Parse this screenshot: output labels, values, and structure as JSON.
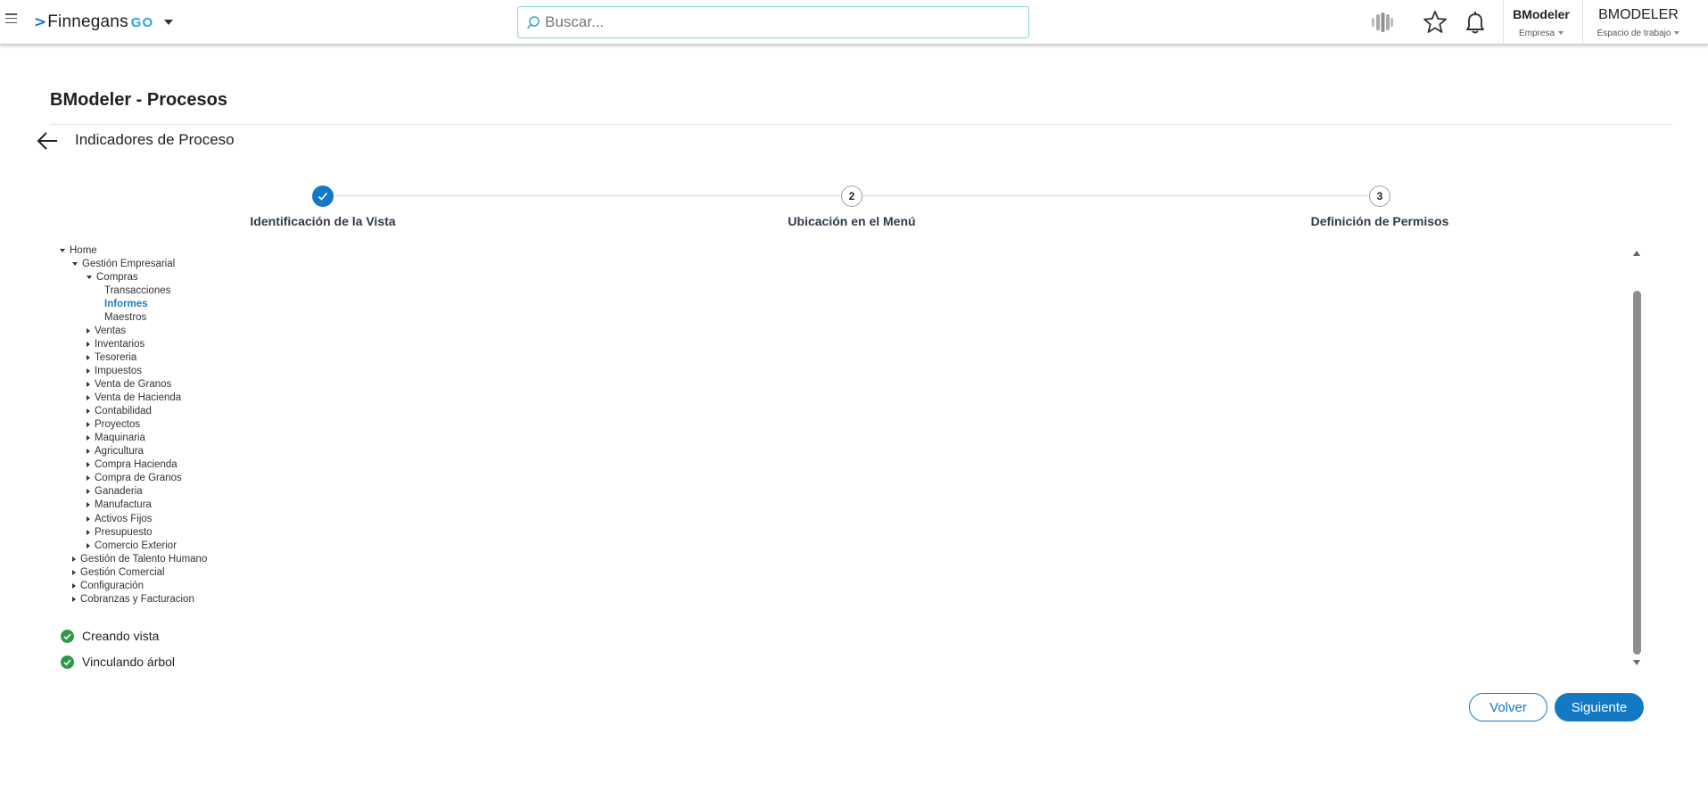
{
  "header": {
    "logo_text": "Finnegans",
    "logo_suffix": "GO",
    "search_placeholder": "Buscar...",
    "company_name": "BModeler",
    "company_label": "Empresa",
    "workspace_name": "BMODELER",
    "workspace_label": "Espacio de trabajo"
  },
  "page": {
    "title": "BModeler - Procesos",
    "subtitle": "Indicadores de Proceso"
  },
  "stepper": {
    "current_step": 1,
    "steps": [
      {
        "number": "",
        "label": "Identificación de la Vista",
        "state": "done"
      },
      {
        "number": "2",
        "label": "Ubicación en el Menú",
        "state": "pending"
      },
      {
        "number": "3",
        "label": "Definición de Permisos",
        "state": "pending"
      }
    ]
  },
  "tree": [
    {
      "label": "Home",
      "level": 0,
      "toggle": "expanded"
    },
    {
      "label": "Gestión Empresarial",
      "level": 1,
      "toggle": "expanded"
    },
    {
      "label": "Compras",
      "level": 2,
      "toggle": "expanded"
    },
    {
      "label": "Transacciones",
      "level": 3,
      "toggle": "none"
    },
    {
      "label": "Informes",
      "level": 3,
      "toggle": "none",
      "selected": true
    },
    {
      "label": "Maestros",
      "level": 3,
      "toggle": "none"
    },
    {
      "label": "Ventas",
      "level": 2,
      "toggle": "collapsed"
    },
    {
      "label": "Inventarios",
      "level": 2,
      "toggle": "collapsed"
    },
    {
      "label": "Tesoreria",
      "level": 2,
      "toggle": "collapsed"
    },
    {
      "label": "Impuestos",
      "level": 2,
      "toggle": "collapsed"
    },
    {
      "label": "Venta de Granos",
      "level": 2,
      "toggle": "collapsed"
    },
    {
      "label": "Venta de Hacienda",
      "level": 2,
      "toggle": "collapsed"
    },
    {
      "label": "Contabilidad",
      "level": 2,
      "toggle": "collapsed"
    },
    {
      "label": "Proyectos",
      "level": 2,
      "toggle": "collapsed"
    },
    {
      "label": "Maquinaria",
      "level": 2,
      "toggle": "collapsed"
    },
    {
      "label": "Agricultura",
      "level": 2,
      "toggle": "collapsed"
    },
    {
      "label": "Compra Hacienda",
      "level": 2,
      "toggle": "collapsed"
    },
    {
      "label": "Compra de Granos",
      "level": 2,
      "toggle": "collapsed"
    },
    {
      "label": "Ganaderia",
      "level": 2,
      "toggle": "collapsed"
    },
    {
      "label": "Manufactura",
      "level": 2,
      "toggle": "collapsed"
    },
    {
      "label": "Activos Fijos",
      "level": 2,
      "toggle": "collapsed"
    },
    {
      "label": "Presupuesto",
      "level": 2,
      "toggle": "collapsed"
    },
    {
      "label": "Comercio Exterior",
      "level": 2,
      "toggle": "collapsed"
    },
    {
      "label": "Gestión de Talento Humano",
      "level": 1,
      "toggle": "collapsed"
    },
    {
      "label": "Gestión Comercial",
      "level": 1,
      "toggle": "collapsed"
    },
    {
      "label": "Configuración",
      "level": 1,
      "toggle": "collapsed"
    },
    {
      "label": "Cobranzas y Facturacion",
      "level": 1,
      "toggle": "collapsed"
    }
  ],
  "status_items": [
    {
      "label": "Creando vista",
      "state": "success"
    },
    {
      "label": "Vinculando árbol",
      "state": "success"
    }
  ],
  "actions": {
    "back_label": "Volver",
    "next_label": "Siguiente"
  },
  "colors": {
    "primary": "#1479c4",
    "selected_tree_item": "#1a7fbd",
    "success": "#2e9a47",
    "search_border": "#7fd3e6"
  }
}
